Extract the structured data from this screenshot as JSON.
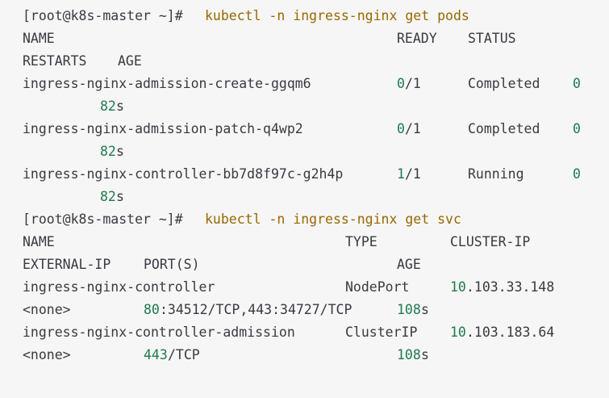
{
  "colors": {
    "background": "#f6f6f6",
    "text": "#383a42",
    "command": "#986801",
    "number": "#1e7a4f"
  },
  "block1": {
    "prompt": "[root@k8s-master ~]# ",
    "command": "kubectl -n ingress-nginx get pods",
    "headers": [
      "NAME",
      "READY",
      "STATUS",
      "RESTARTS",
      "AGE"
    ],
    "rows": [
      {
        "name": "ingress-nginx-admission-create-ggqm6",
        "ready_a": "0",
        "ready_b": "/1",
        "status": "Completed",
        "restarts": "0",
        "age_num": "82",
        "age_unit": "s"
      },
      {
        "name": "ingress-nginx-admission-patch-q4wp2",
        "ready_a": "0",
        "ready_b": "/1",
        "status": "Completed",
        "restarts": "0",
        "age_num": "82",
        "age_unit": "s"
      },
      {
        "name": "ingress-nginx-controller-bb7d8f97c-g2h4p",
        "ready_a": "1",
        "ready_b": "/1",
        "status": "Running",
        "restarts": "0",
        "age_num": "82",
        "age_unit": "s"
      }
    ]
  },
  "block2": {
    "prompt": "[root@k8s-master ~]# ",
    "command": "kubectl -n ingress-nginx get svc",
    "headers": [
      "NAME",
      "TYPE",
      "CLUSTER-IP",
      "EXTERNAL-IP",
      "PORT(S)",
      "AGE"
    ],
    "rows": [
      {
        "name": "ingress-nginx-controller",
        "type": "NodePort",
        "cluster_ip_a": "10",
        "cluster_ip_b": ".103.33.148",
        "external_ip": "<none>",
        "ports_a": "80",
        "ports_b": ":34512/TCP,443:34727/TCP",
        "age_num": "108",
        "age_unit": "s"
      },
      {
        "name": "ingress-nginx-controller-admission",
        "type": "ClusterIP",
        "cluster_ip_a": "10",
        "cluster_ip_b": ".103.183.64",
        "external_ip": "<none>",
        "ports_a": "443",
        "ports_b": "/TCP",
        "age_num": "108",
        "age_unit": "s"
      }
    ]
  }
}
